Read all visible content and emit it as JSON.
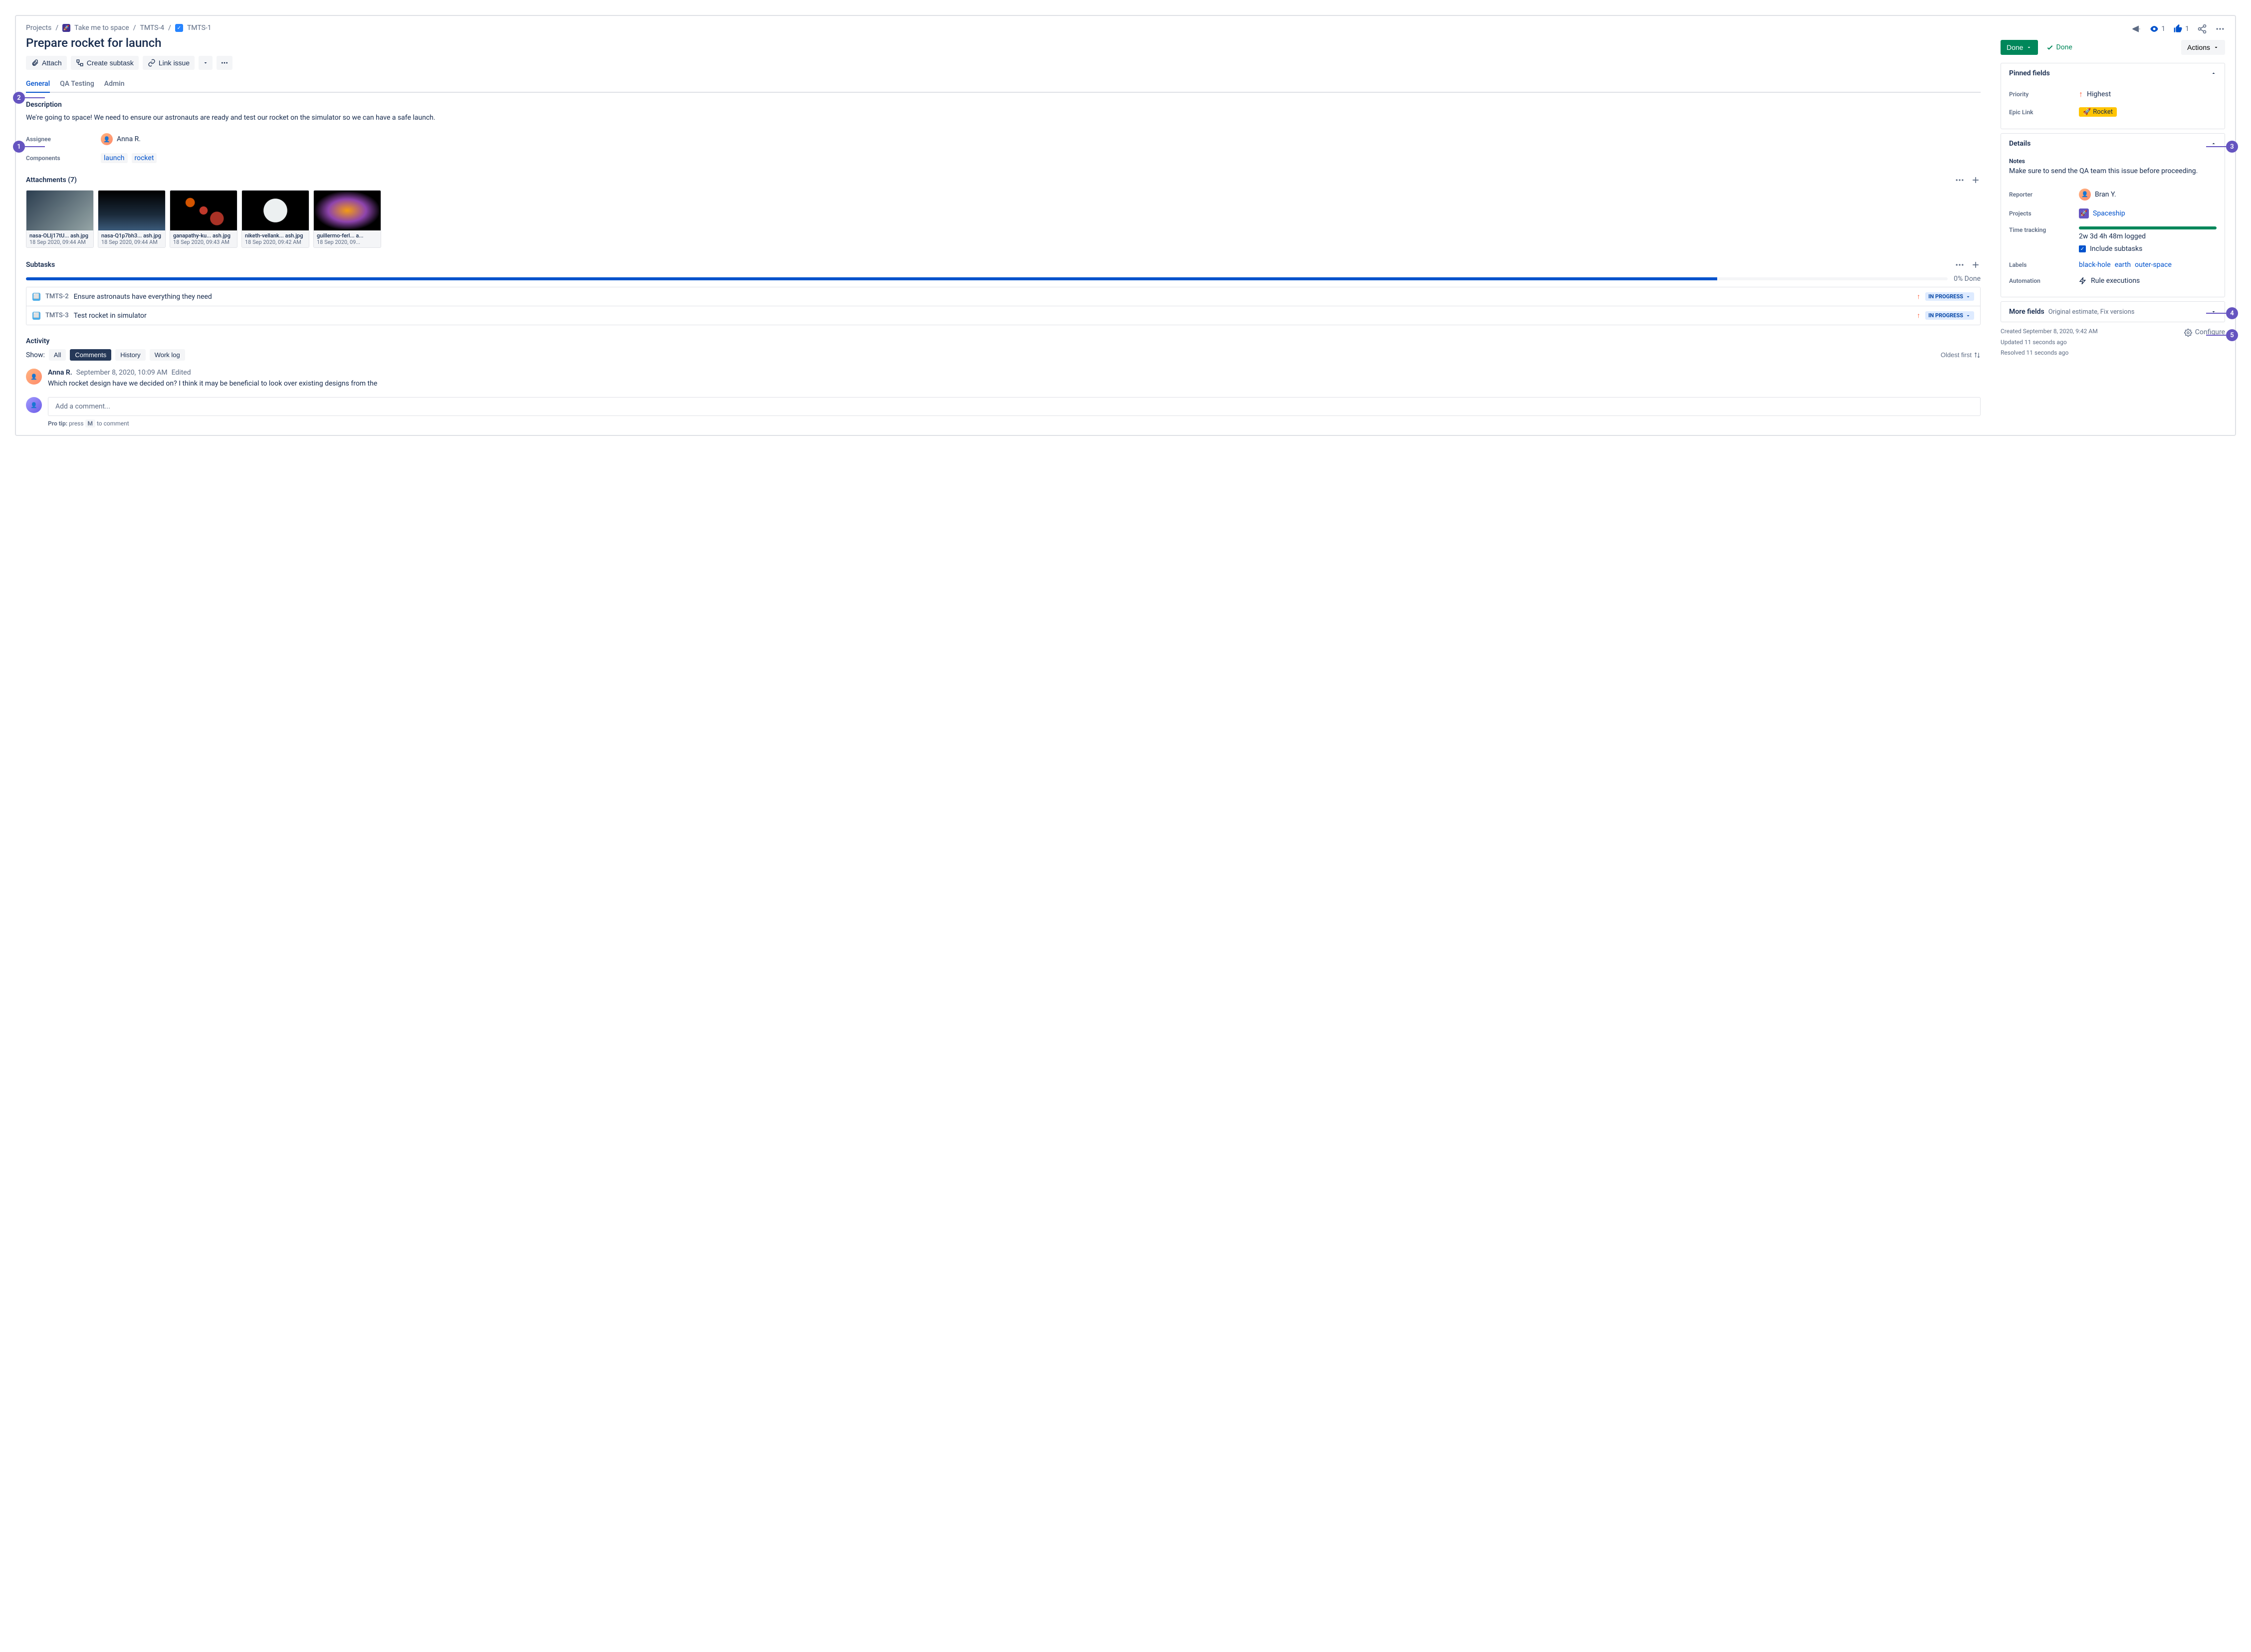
{
  "breadcrumb": {
    "projects": "Projects",
    "project_name": "Take me to space",
    "parent_key": "TMTS-4",
    "issue_key": "TMTS-1"
  },
  "title": "Prepare rocket for launch",
  "toolbar": {
    "attach": "Attach",
    "create_subtask": "Create subtask",
    "link_issue": "Link issue"
  },
  "tabs": [
    "General",
    "QA Testing",
    "Admin"
  ],
  "description": {
    "heading": "Description",
    "text": "We're going to space! We need to ensure our astronauts are ready and test our rocket on the simulator so we can have a safe launch."
  },
  "fields": {
    "assignee_label": "Assignee",
    "assignee_name": "Anna R.",
    "components_label": "Components",
    "components": [
      "launch",
      "rocket"
    ]
  },
  "attachments": {
    "heading": "Attachments (7)",
    "items": [
      {
        "name": "nasa-OLIj17tU... ash.jpg",
        "date": "18 Sep 2020, 09:44 AM"
      },
      {
        "name": "nasa-Q1p7bh3... ash.jpg",
        "date": "18 Sep 2020, 09:44 AM"
      },
      {
        "name": "ganapathy-ku... ash.jpg",
        "date": "18 Sep 2020, 09:43 AM"
      },
      {
        "name": "niketh-vellank... ash.jpg",
        "date": "18 Sep 2020, 09:42 AM"
      },
      {
        "name": "guillermo-ferl... a...",
        "date": "18 Sep 2020, 09..."
      }
    ]
  },
  "subtasks": {
    "heading": "Subtasks",
    "progress_label": "0% Done",
    "items": [
      {
        "key": "TMTS-2",
        "title": "Ensure astronauts have everything they need",
        "status": "IN PROGRESS"
      },
      {
        "key": "TMTS-3",
        "title": "Test rocket in simulator",
        "status": "IN PROGRESS"
      }
    ]
  },
  "activity": {
    "heading": "Activity",
    "show_label": "Show:",
    "filters": [
      "All",
      "Comments",
      "History",
      "Work log"
    ],
    "sort": "Oldest first",
    "comment": {
      "author": "Anna R.",
      "date": "September 8, 2020, 10:09 AM",
      "edited": "Edited",
      "text": "Which rocket design have we decided on? I think it may be beneficial to look over existing designs from the"
    },
    "add_placeholder": "Add a comment...",
    "protip_pre": "Pro tip:",
    "protip_press": "press",
    "protip_key": "M",
    "protip_post": "to comment"
  },
  "top_actions": {
    "watchers": "1",
    "votes": "1"
  },
  "status": {
    "done_btn": "Done",
    "done_link": "Done",
    "actions": "Actions"
  },
  "pinned": {
    "heading": "Pinned fields",
    "priority_label": "Priority",
    "priority_value": "Highest",
    "epic_label": "Epic Link",
    "epic_value": "Rocket"
  },
  "details": {
    "heading": "Details",
    "notes_label": "Notes",
    "notes_text": "Make sure to send the QA team this issue before proceeding.",
    "reporter_label": "Reporter",
    "reporter_name": "Bran Y.",
    "projects_label": "Projects",
    "projects_value": "Spaceship",
    "time_label": "Time tracking",
    "time_logged": "2w 3d 4h 48m logged",
    "include_subtasks": "Include subtasks",
    "labels_label": "Labels",
    "labels": [
      "black-hole",
      "earth",
      "outer-space"
    ],
    "automation_label": "Automation",
    "automation_value": "Rule executions"
  },
  "more_fields": {
    "title": "More fields",
    "subtitle": "Original estimate, Fix versions"
  },
  "footer": {
    "created": "Created September 8, 2020, 9:42 AM",
    "updated": "Updated 11 seconds ago",
    "resolved": "Resolved 11 seconds ago",
    "configure": "Configure"
  },
  "callouts": {
    "c1": "1",
    "c2": "2",
    "c3": "3",
    "c4": "4",
    "c5": "5"
  }
}
